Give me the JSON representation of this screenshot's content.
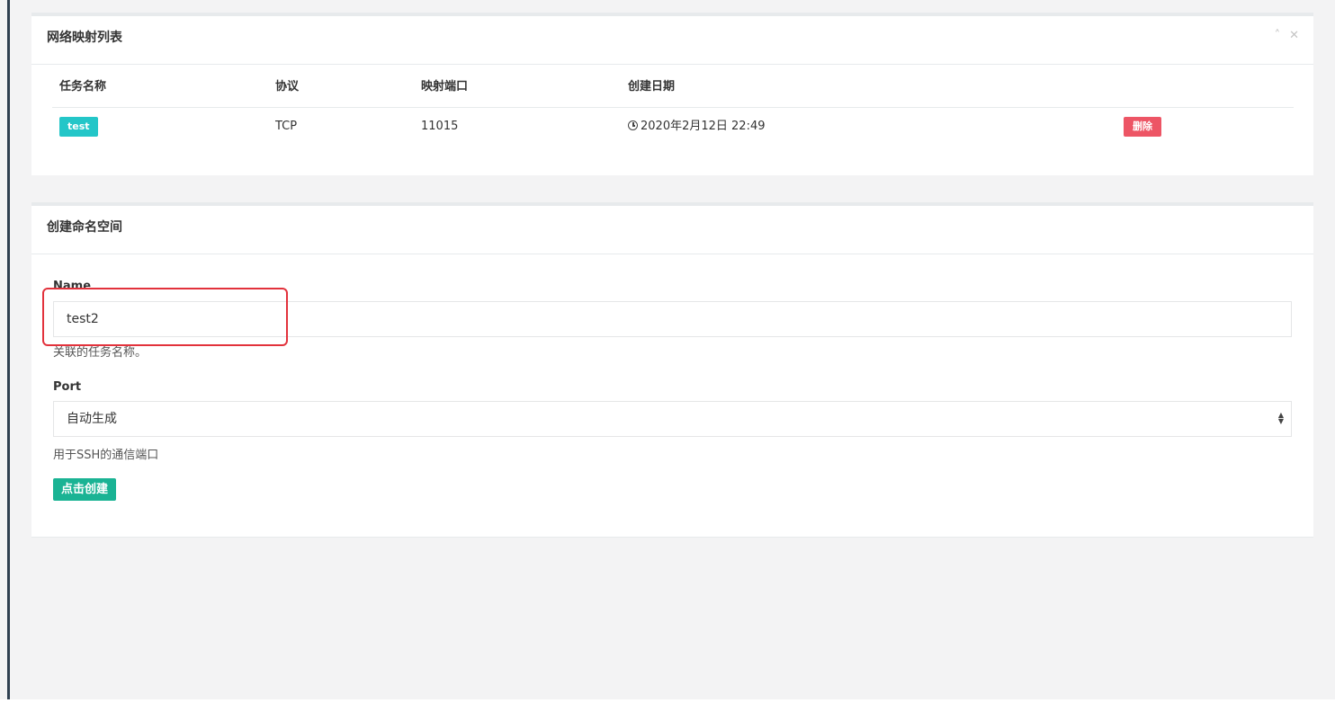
{
  "network_panel": {
    "title": "网络映射列表",
    "tools": {
      "collapse_icon": "chevron-up-icon",
      "close_icon": "close-icon"
    },
    "columns": [
      "任务名称",
      "协议",
      "映射端口",
      "创建日期"
    ],
    "rows": [
      {
        "name": "test",
        "protocol": "TCP",
        "port": "11015",
        "created": "2020年2月12日 22:49",
        "delete_label": "删除"
      }
    ]
  },
  "create_panel": {
    "title": "创建命名空间",
    "name_field": {
      "label": "Name",
      "value": "test2",
      "help": "关联的任务名称。"
    },
    "port_field": {
      "label": "Port",
      "selected": "自动生成",
      "help": "用于SSH的通信端口"
    },
    "submit_label": "点击创建"
  },
  "colors": {
    "name_label": "#23c6c8",
    "delete": "#ed5565",
    "submit": "#1ab394",
    "highlight": "#e2323c"
  }
}
